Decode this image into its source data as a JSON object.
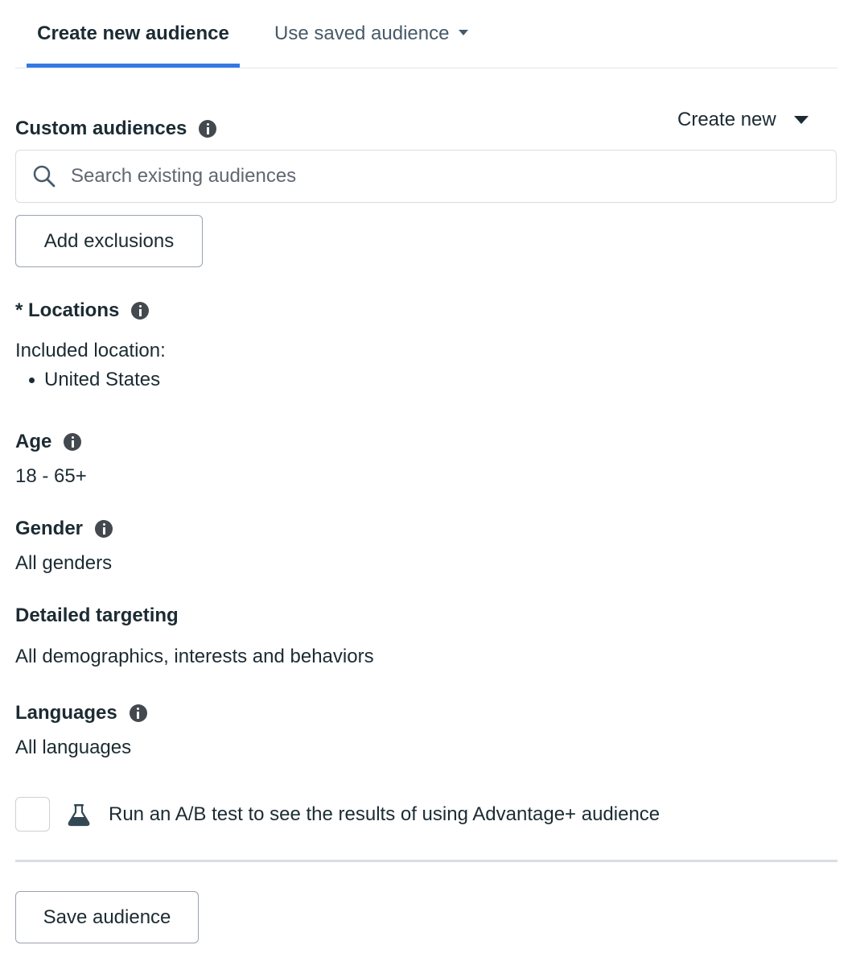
{
  "tabs": {
    "create_new": "Create new audience",
    "use_saved": "Use saved audience"
  },
  "accent_color": "#3578e5",
  "custom_audiences": {
    "label": "Custom audiences",
    "create_new_label": "Create new",
    "search_placeholder": "Search existing audiences",
    "search_value": "",
    "add_exclusions_label": "Add exclusions"
  },
  "locations": {
    "label": "* Locations",
    "included_label": "Included location:",
    "items": [
      "United States"
    ]
  },
  "age": {
    "label": "Age",
    "value": "18 - 65+"
  },
  "gender": {
    "label": "Gender",
    "value": "All genders"
  },
  "detailed_targeting": {
    "label": "Detailed targeting",
    "value": "All demographics, interests and behaviors"
  },
  "languages": {
    "label": "Languages",
    "value": "All languages"
  },
  "ab_test": {
    "checked": false,
    "icon": "flask-icon",
    "label": "Run an A/B test to see the results of using Advantage+ audience"
  },
  "footer": {
    "save_label": "Save audience"
  }
}
